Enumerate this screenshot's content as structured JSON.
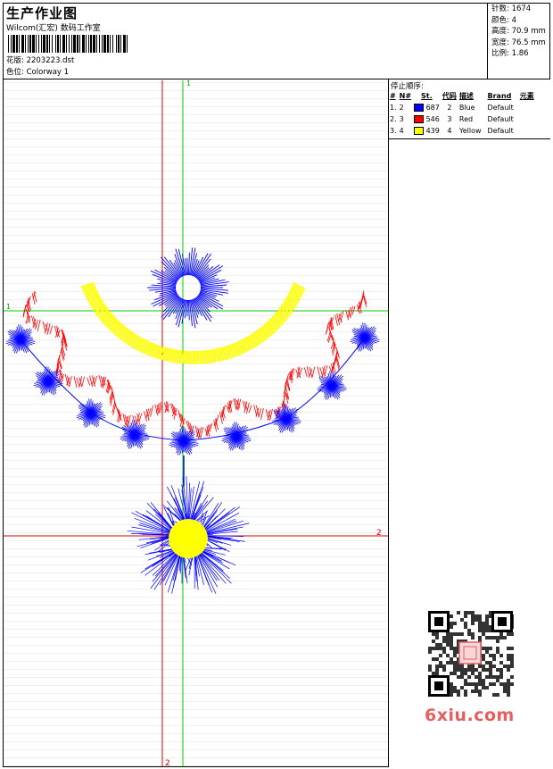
{
  "header": {
    "title": "生产作业图",
    "company": "Wilcom(汇宏) 数码工作室",
    "design_label": "花版:",
    "design_value": "2203223.dst",
    "colorway_label": "色位:",
    "colorway_value": "Colorway 1"
  },
  "stats": {
    "stitches_label": "针数:",
    "stitches_value": "1674",
    "colors_label": "颜色:",
    "colors_value": "4",
    "height_label": "高度:",
    "height_value": "70.9 mm",
    "width_label": "宽度:",
    "width_value": "76.5 mm",
    "scale_label": "比例:",
    "scale_value": "1.86"
  },
  "stop_sequence": {
    "title": "停止顺序:",
    "columns": [
      "#",
      "N#",
      "St.",
      "代码",
      "描述",
      "Brand",
      "元素"
    ],
    "rows": [
      {
        "idx": "1.",
        "n": "2",
        "color": "#0000ff",
        "st": "687",
        "code": "2",
        "desc": "Blue",
        "brand": "Default"
      },
      {
        "idx": "2.",
        "n": "3",
        "color": "#ff0000",
        "st": "546",
        "code": "3",
        "desc": "Red",
        "brand": "Default"
      },
      {
        "idx": "3.",
        "n": "4",
        "color": "#ffff00",
        "st": "439",
        "code": "4",
        "desc": "Yellow",
        "brand": "Default"
      }
    ]
  },
  "guides": {
    "top_label": "1",
    "left_label": "1",
    "right_label": "2",
    "bottom_label": "2"
  },
  "watermark": {
    "site": "6xiu.com"
  },
  "palette": {
    "blue": "#0000ff",
    "red": "#ff0000",
    "yellow": "#ffff00",
    "guide_red": "#ff0000",
    "guide_green": "#00cc00"
  }
}
